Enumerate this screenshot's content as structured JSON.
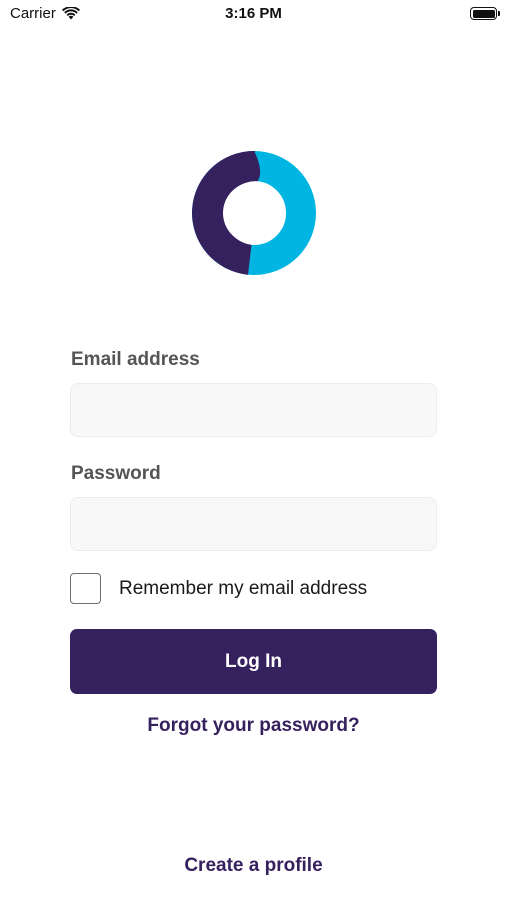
{
  "status_bar": {
    "carrier": "Carrier",
    "time": "3:16 PM"
  },
  "colors": {
    "brand_purple": "#36215f",
    "brand_cyan": "#00b5e2"
  },
  "login_form": {
    "email_label": "Email address",
    "email_value": "",
    "password_label": "Password",
    "password_value": "",
    "remember_label": "Remember my email address",
    "remember_checked": false,
    "login_button": "Log In",
    "forgot_password_link": "Forgot your password?"
  },
  "footer": {
    "create_profile_link": "Create a profile"
  }
}
